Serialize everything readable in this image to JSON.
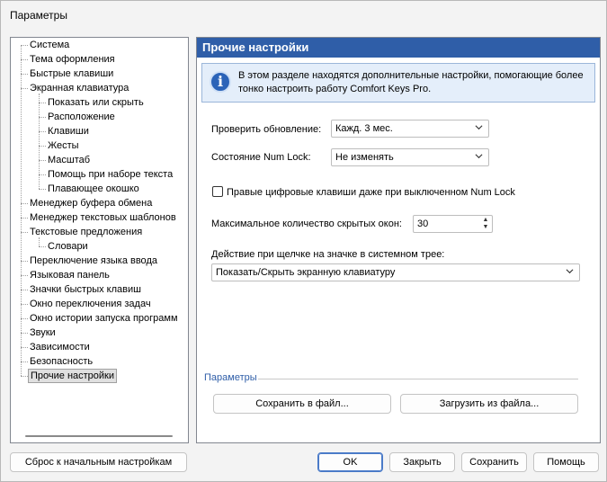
{
  "window": {
    "title": "Параметры"
  },
  "tree": {
    "items": [
      {
        "label": "Система",
        "level": 0
      },
      {
        "label": "Тема оформления",
        "level": 0
      },
      {
        "label": "Быстрые клавиши",
        "level": 0
      },
      {
        "label": "Экранная клавиатура",
        "level": 0
      },
      {
        "label": "Показать или скрыть",
        "level": 1
      },
      {
        "label": "Расположение",
        "level": 1
      },
      {
        "label": "Клавиши",
        "level": 1
      },
      {
        "label": "Жесты",
        "level": 1
      },
      {
        "label": "Масштаб",
        "level": 1
      },
      {
        "label": "Помощь при наборе текста",
        "level": 1
      },
      {
        "label": "Плавающее окошко",
        "level": 1
      },
      {
        "label": "Менеджер буфера обмена",
        "level": 0
      },
      {
        "label": "Менеджер текстовых шаблонов",
        "level": 0
      },
      {
        "label": "Текстовые предложения",
        "level": 0
      },
      {
        "label": "Словари",
        "level": 1
      },
      {
        "label": "Переключение языка ввода",
        "level": 0
      },
      {
        "label": "Языковая панель",
        "level": 0
      },
      {
        "label": "Значки быстрых клавиш",
        "level": 0
      },
      {
        "label": "Окно переключения задач",
        "level": 0
      },
      {
        "label": "Окно истории запуска программ",
        "level": 0
      },
      {
        "label": "Звуки",
        "level": 0
      },
      {
        "label": "Зависимости",
        "level": 0
      },
      {
        "label": "Безопасность",
        "level": 0
      },
      {
        "label": "Прочие настройки",
        "level": 0,
        "selected": true
      }
    ]
  },
  "panel": {
    "header": "Прочие настройки",
    "info": "В этом разделе находятся дополнительные настройки, помогающие более тонко настроить работу Comfort Keys Pro.",
    "check_update_label": "Проверить обновление:",
    "check_update_value": "Кажд. 3 мес.",
    "numlock_label": "Состояние Num Lock:",
    "numlock_value": "Не изменять",
    "numpad_checkbox_label": "Правые цифровые клавиши даже при выключенном Num Lock",
    "numpad_checked": false,
    "max_hidden_label": "Максимальное количество скрытых окон:",
    "max_hidden_value": "30",
    "tray_action_label": "Действие при щелчке на значке в системном трее:",
    "tray_action_value": "Показать/Скрыть экранную клавиатуру",
    "group_label": "Параметры",
    "save_to_file": "Сохранить в файл...",
    "load_from_file": "Загрузить из файла..."
  },
  "footer": {
    "reset": "Сброс к начальным настройкам",
    "ok": "OK",
    "close": "Закрыть",
    "save": "Сохранить",
    "help": "Помощь"
  },
  "colors": {
    "header_bg": "#2f5ea8",
    "info_bg": "#e4eefa",
    "accent": "#2f5ea8"
  }
}
